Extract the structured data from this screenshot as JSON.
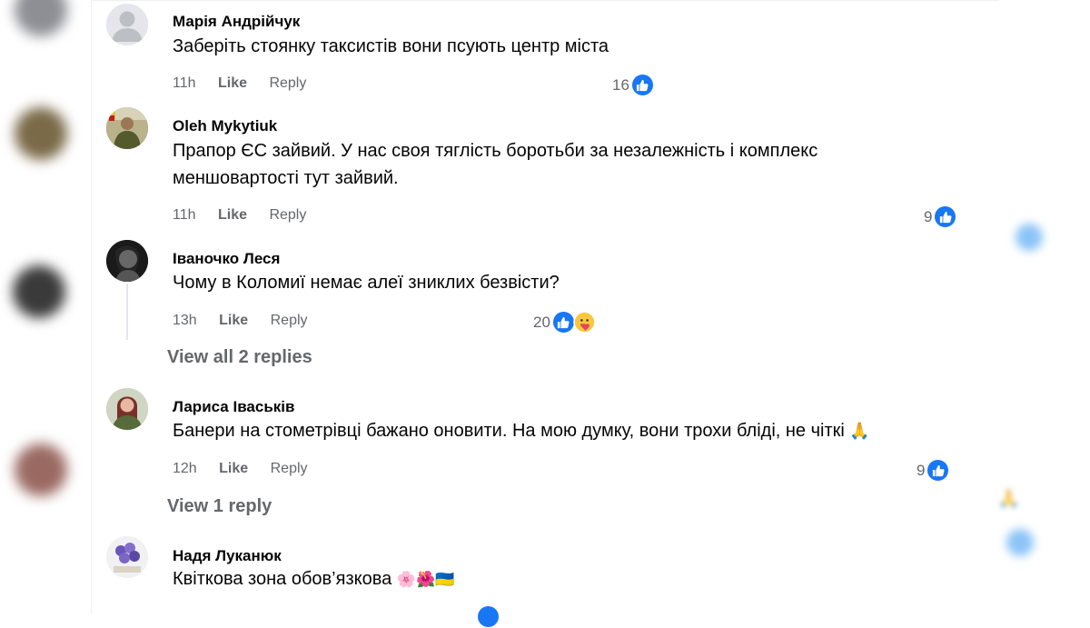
{
  "comments": [
    {
      "author": "Марія Андрійчук",
      "text": "Заберіть стоянку таксистів вони псують центр міста",
      "time": "11h",
      "like_label": "Like",
      "reply_label": "Reply",
      "reaction_count": "16",
      "reactions": [
        "like-icon"
      ]
    },
    {
      "author": "Oleh Mykytiuk",
      "text_line1": "Прапор ЄС зайвий. У нас своя тяглість боротьби за незалежність і комплекс",
      "text_line2": "меншовартості тут зайвий.",
      "time": "11h",
      "like_label": "Like",
      "reply_label": "Reply",
      "reaction_count": "9",
      "reactions": [
        "like-icon"
      ]
    },
    {
      "author": "Іваночко Леся",
      "text": "Чому в Коломиї немає алеї зниклих безвісти?",
      "time": "13h",
      "like_label": "Like",
      "reply_label": "Reply",
      "reaction_count": "20",
      "reactions": [
        "like-icon",
        "care-icon"
      ],
      "view_replies": "View all 2 replies"
    },
    {
      "author": "Лариса Іваськів",
      "text": "Банери на стометрівці бажано оновити. На мою думку, вони трохи бліді, не чіткі",
      "trailing_emoji": "🙏",
      "time": "12h",
      "like_label": "Like",
      "reply_label": "Reply",
      "reaction_count": "9",
      "reactions": [
        "like-icon"
      ],
      "view_replies": "View 1 reply"
    },
    {
      "author": "Надя Луканюк",
      "text": "Квіткова зона обов’язкова",
      "trailing_emoji": "🌸🌺🇺🇦"
    }
  ],
  "colors": {
    "like_blue": "#1877f2",
    "secondary_text": "#65676b",
    "primary_text": "#050505"
  }
}
